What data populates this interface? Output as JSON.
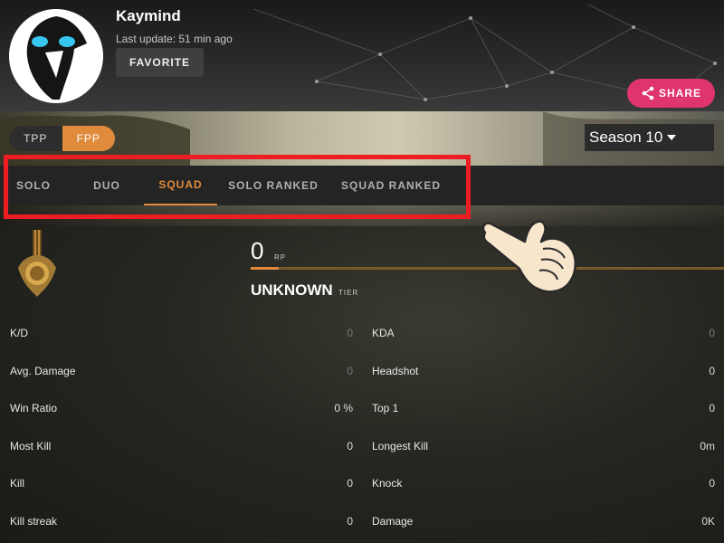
{
  "profile": {
    "username": "Kaymind",
    "last_update": "Last update: 51 min ago",
    "favorite_label": "FAVORITE",
    "share_label": "SHARE"
  },
  "mode_toggle": {
    "options": [
      "TPP",
      "FPP"
    ],
    "selected": "FPP"
  },
  "season": {
    "label": "Season 10"
  },
  "tabs": [
    {
      "label": "SOLO",
      "active": false
    },
    {
      "label": "DUO",
      "active": false
    },
    {
      "label": "SQUAD",
      "active": true
    },
    {
      "label": "SOLO RANKED",
      "active": false
    },
    {
      "label": "SQUAD RANKED",
      "active": false
    }
  ],
  "rank": {
    "rp_value": "0",
    "rp_unit": "RP",
    "progress_fraction": 0.06,
    "tier": "UNKNOWN",
    "tier_unit": "TIER"
  },
  "stats_left": [
    {
      "label": "K/D",
      "value": "0"
    },
    {
      "label": "Avg. Damage",
      "value": "0"
    },
    {
      "label": "Win Ratio",
      "value": "0 %"
    },
    {
      "label": "Most Kill",
      "value": "0"
    },
    {
      "label": "Kill",
      "value": "0"
    },
    {
      "label": "Kill streak",
      "value": "0"
    }
  ],
  "stats_right": [
    {
      "label": "KDA",
      "value": "0"
    },
    {
      "label": "Headshot",
      "value": "0"
    },
    {
      "label": "Top 1",
      "value": "0"
    },
    {
      "label": "Longest Kill",
      "value": "0m"
    },
    {
      "label": "Knock",
      "value": "0"
    },
    {
      "label": "Damage",
      "value": "0K"
    }
  ],
  "colors": {
    "accent_orange": "#e08b3c",
    "share_pink": "#e0346e",
    "highlight_red": "#ee1d23"
  },
  "icons": {
    "avatar": "crow-mask-avatar",
    "share": "share-icon",
    "season_caret": "caret-down-icon",
    "medal": "rank-medal-icon",
    "pointer": "pointing-hand-icon"
  }
}
